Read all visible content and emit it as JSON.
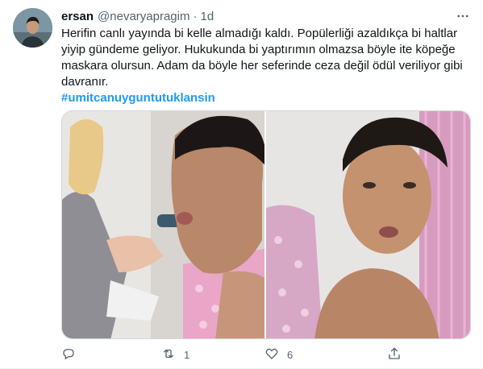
{
  "tweet": {
    "author_name": "ersan",
    "author_handle": "@nevaryapragim",
    "separator": "·",
    "time": "1d",
    "text": "Herifin canlı yayında bi kelle almadığı kaldı. Popülerliği azaldıkça bi haltlar yiyip gündeme geliyor. Hukukunda bi yaptırımın olmazsa böyle ite köpeğe maskara olursun. Adam da böyle her seferinde ceza değil ödül veriliyor gibi davranır.",
    "hashtag": "#umitcanuyguntutuklansin"
  },
  "actions": {
    "reply_count": "",
    "retweet_count": "1",
    "like_count": "6"
  },
  "icons": {
    "more": "more-dots-icon",
    "reply": "reply-icon",
    "retweet": "retweet-icon",
    "like": "heart-icon",
    "share": "share-icon"
  },
  "colors": {
    "accent": "#1d9bf0",
    "secondary_text": "#536471",
    "primary_text": "#0f1419"
  }
}
